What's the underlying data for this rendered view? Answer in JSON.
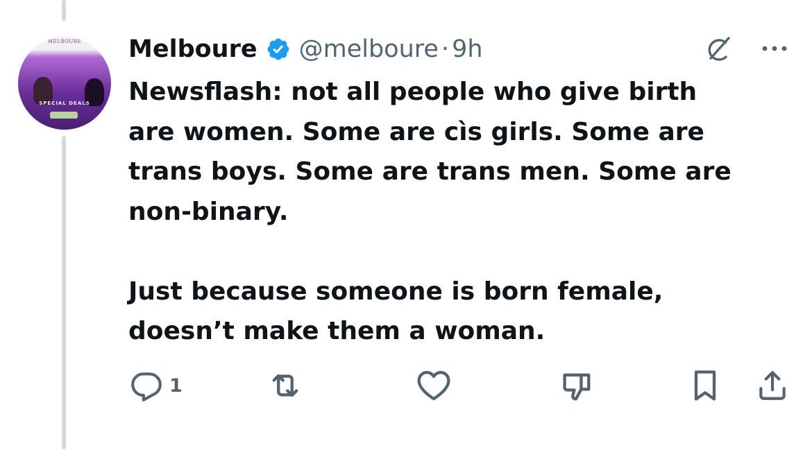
{
  "tweet": {
    "author": {
      "display_name": "Melboure",
      "handle": "@melboure",
      "verified": true,
      "avatar": {
        "brand_text": "MELBOURE",
        "caption": "SPECIAL DEALS"
      }
    },
    "separator": "·",
    "timestamp": "9h",
    "text_lines": [
      "Newsflash: not all people who give birth",
      "are women. Some are cìs girls. Some are",
      "trans boys. Some are trans men. Some are",
      "non-binary.",
      "Just because someone is born female,",
      "doesn’t make them a woman."
    ]
  },
  "actions": {
    "reply_count": "1",
    "icons": [
      "reply-icon",
      "retweet-icon",
      "like-icon",
      "dislike-icon",
      "bookmark-icon",
      "share-icon"
    ]
  },
  "header_icons": [
    "grok-icon",
    "more-icon"
  ],
  "colors": {
    "text": "#0f1419",
    "secondary": "#536471",
    "verified": "#1d9bf0",
    "thread_line": "#cfd9de"
  }
}
